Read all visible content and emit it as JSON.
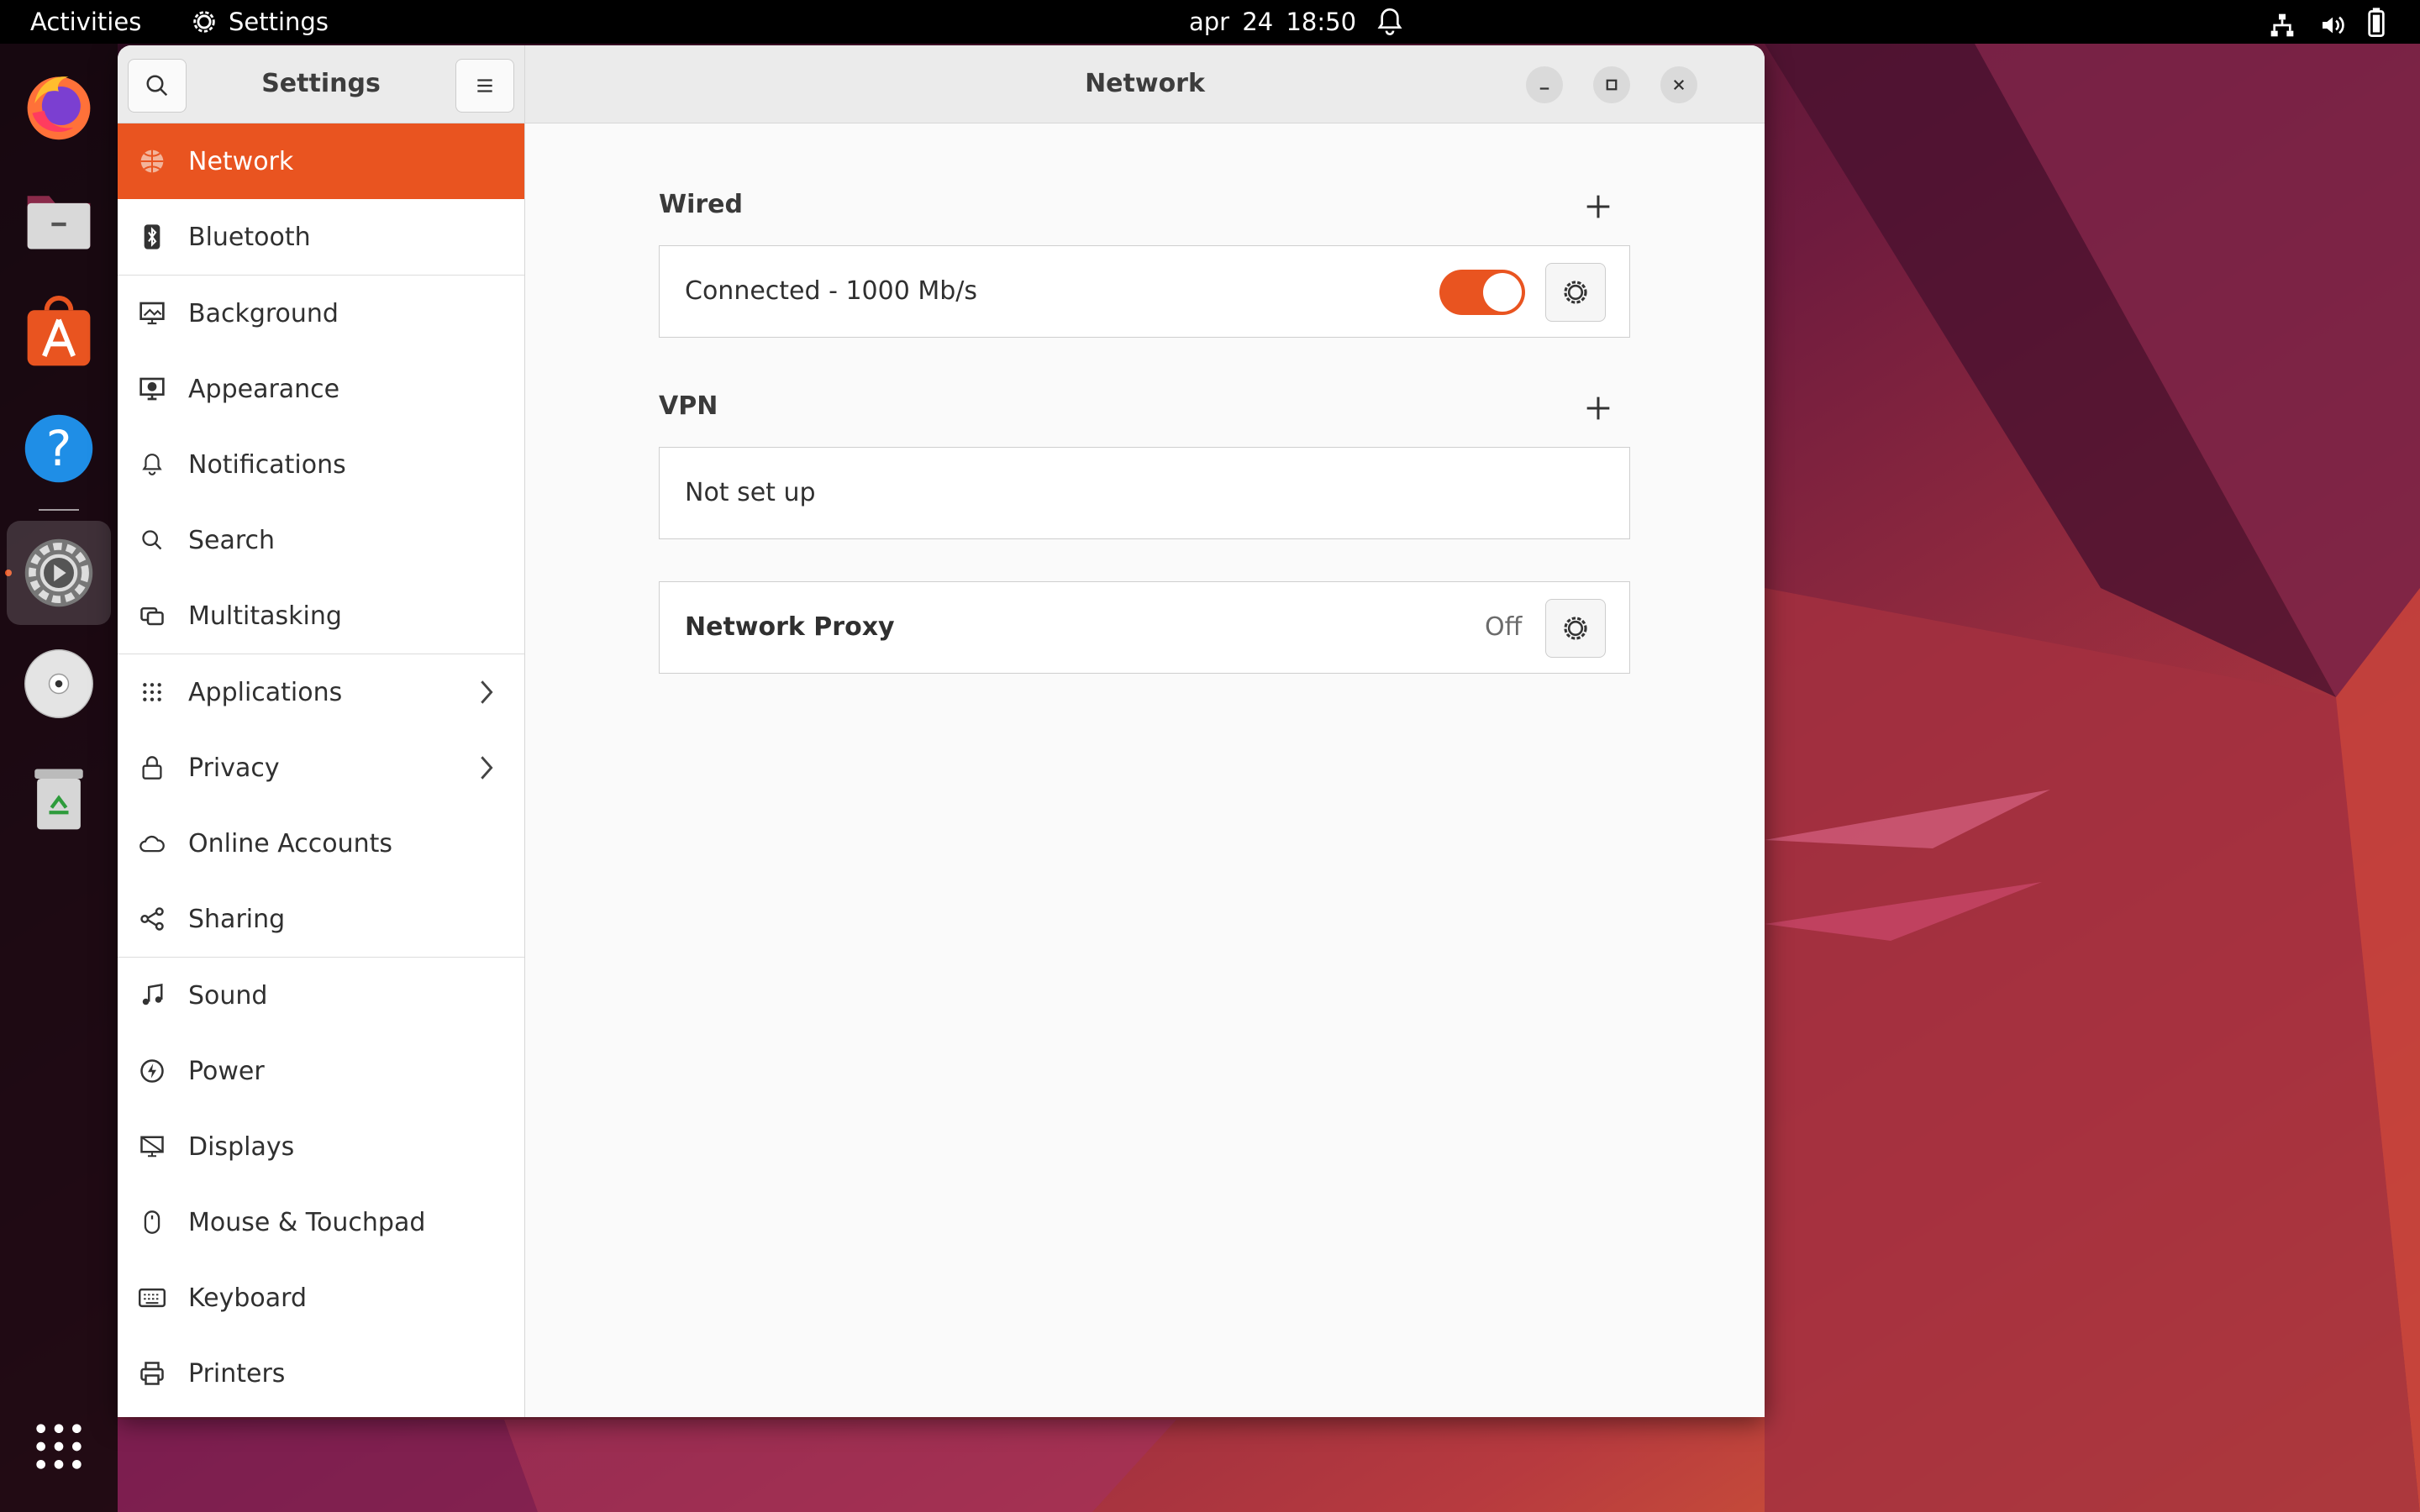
{
  "topbar": {
    "activities": "Activities",
    "app_name": "Settings",
    "clock": "apr  24  18:50"
  },
  "dock": {
    "items": [
      "firefox-icon",
      "files-icon",
      "software-icon",
      "help-icon",
      "settings-icon",
      "disc-icon",
      "trash-icon",
      "app-grid-icon"
    ]
  },
  "window": {
    "sidebar_title": "Settings",
    "title": "Network"
  },
  "sidebar": {
    "items": [
      {
        "label": "Network",
        "icon": "network-icon"
      },
      {
        "label": "Bluetooth",
        "icon": "bluetooth-icon"
      },
      {
        "label": "Background",
        "icon": "background-icon"
      },
      {
        "label": "Appearance",
        "icon": "appearance-icon"
      },
      {
        "label": "Notifications",
        "icon": "bell-icon"
      },
      {
        "label": "Search",
        "icon": "search-icon"
      },
      {
        "label": "Multitasking",
        "icon": "multitasking-icon"
      },
      {
        "label": "Applications",
        "icon": "applications-icon"
      },
      {
        "label": "Privacy",
        "icon": "lock-icon"
      },
      {
        "label": "Online Accounts",
        "icon": "cloud-icon"
      },
      {
        "label": "Sharing",
        "icon": "share-icon"
      },
      {
        "label": "Sound",
        "icon": "music-note-icon"
      },
      {
        "label": "Power",
        "icon": "power-icon"
      },
      {
        "label": "Displays",
        "icon": "display-icon"
      },
      {
        "label": "Mouse & Touchpad",
        "icon": "mouse-icon"
      },
      {
        "label": "Keyboard",
        "icon": "keyboard-icon"
      },
      {
        "label": "Printers",
        "icon": "printer-icon"
      }
    ]
  },
  "main": {
    "wired": {
      "title": "Wired",
      "status": "Connected - 1000 Mb/s",
      "enabled": true
    },
    "vpn": {
      "title": "VPN",
      "status": "Not set up"
    },
    "proxy": {
      "label": "Network Proxy",
      "state": "Off"
    }
  },
  "colors": {
    "accent": "#e95420",
    "window_bg": "#fafafa",
    "topbar_bg": "#000000"
  }
}
